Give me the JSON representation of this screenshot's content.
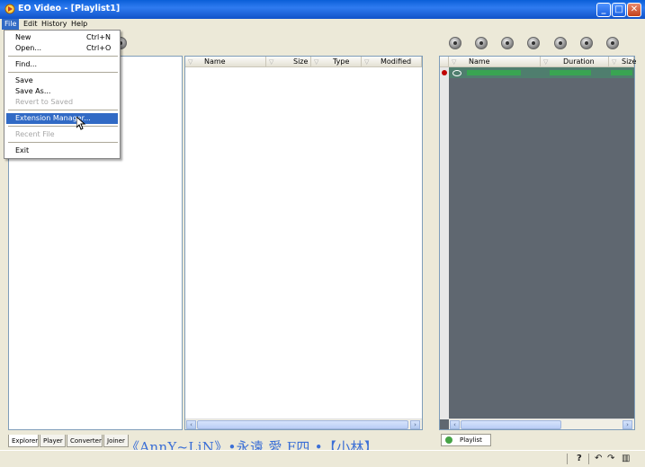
{
  "window": {
    "title": "EO Video - [Playlist1]",
    "minimize": "_",
    "maximize": "□",
    "close": "✕"
  },
  "menubar": {
    "items": [
      "File",
      "Edit",
      "History",
      "Help"
    ]
  },
  "file_menu": {
    "items": [
      {
        "label": "New",
        "shortcut": "Ctrl+N"
      },
      {
        "label": "Open...",
        "shortcut": "Ctrl+O"
      },
      {
        "label": "Find..."
      },
      {
        "label": "Save"
      },
      {
        "label": "Save As..."
      },
      {
        "label": "Revert to Saved"
      },
      {
        "label": "Extension Manager..."
      },
      {
        "label": "Recent File"
      },
      {
        "label": "Exit"
      }
    ]
  },
  "file_list": {
    "columns": [
      "Name",
      "Size",
      "Type",
      "Modified"
    ]
  },
  "playlist": {
    "columns": [
      "Name",
      "Duration",
      "Size"
    ],
    "tab_label": "Playlist"
  },
  "bottom_tabs": [
    "Explorer",
    "Player",
    "Converter",
    "Joiner"
  ],
  "watermark": "《AnnY~LiN》•永遠 愛 F四 •【小林】",
  "status": {
    "help": "?"
  },
  "colors": {
    "titlebar": "#0a5fd8",
    "menu_highlight": "#316ac5",
    "playlist_bg": "#5f6770",
    "watermark": "#3b6fd6"
  }
}
